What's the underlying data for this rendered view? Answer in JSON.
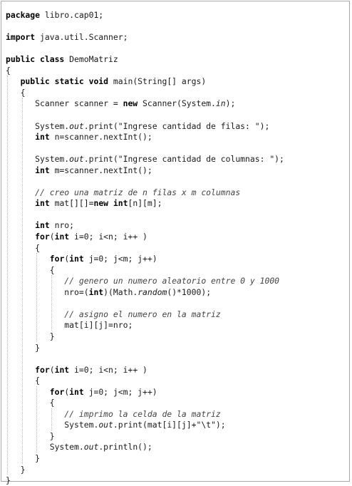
{
  "code": {
    "lines": [
      [
        {
          "t": "package",
          "c": "kw"
        },
        {
          "t": " libro.cap01;"
        }
      ],
      [],
      [
        {
          "t": "import",
          "c": "kw"
        },
        {
          "t": " java.util.Scanner;"
        }
      ],
      [],
      [
        {
          "t": "public class",
          "c": "kw"
        },
        {
          "t": " DemoMatriz"
        }
      ],
      [
        {
          "t": "{"
        }
      ],
      [
        {
          "t": "   "
        },
        {
          "t": "public static void",
          "c": "kw"
        },
        {
          "t": " main(String[] args)"
        }
      ],
      [
        {
          "t": "   {"
        }
      ],
      [
        {
          "t": "      Scanner scanner = "
        },
        {
          "t": "new",
          "c": "kw"
        },
        {
          "t": " Scanner(System."
        },
        {
          "t": "in",
          "c": "it"
        },
        {
          "t": ");"
        }
      ],
      [],
      [
        {
          "t": "      System."
        },
        {
          "t": "out",
          "c": "it"
        },
        {
          "t": ".print(\"Ingrese cantidad de filas: \");"
        }
      ],
      [
        {
          "t": "      "
        },
        {
          "t": "int",
          "c": "kw"
        },
        {
          "t": " n=scanner.nextInt();"
        }
      ],
      [],
      [
        {
          "t": "      System."
        },
        {
          "t": "out",
          "c": "it"
        },
        {
          "t": ".print(\"Ingrese cantidad de columnas: \");"
        }
      ],
      [
        {
          "t": "      "
        },
        {
          "t": "int",
          "c": "kw"
        },
        {
          "t": " m=scanner.nextInt();"
        }
      ],
      [],
      [
        {
          "t": "      "
        },
        {
          "t": "// creo una matriz de n filas x m columnas",
          "c": "cm"
        }
      ],
      [
        {
          "t": "      "
        },
        {
          "t": "int",
          "c": "kw"
        },
        {
          "t": " mat[][]="
        },
        {
          "t": "new int",
          "c": "kw"
        },
        {
          "t": "[n][m];"
        }
      ],
      [],
      [
        {
          "t": "      "
        },
        {
          "t": "int",
          "c": "kw"
        },
        {
          "t": " nro;"
        }
      ],
      [
        {
          "t": "      "
        },
        {
          "t": "for",
          "c": "kw"
        },
        {
          "t": "("
        },
        {
          "t": "int",
          "c": "kw"
        },
        {
          "t": " i=0; i<n; i++ )"
        }
      ],
      [
        {
          "t": "      {"
        }
      ],
      [
        {
          "t": "         "
        },
        {
          "t": "for",
          "c": "kw"
        },
        {
          "t": "("
        },
        {
          "t": "int",
          "c": "kw"
        },
        {
          "t": " j=0; j<m; j++)"
        }
      ],
      [
        {
          "t": "         {"
        }
      ],
      [
        {
          "t": "            "
        },
        {
          "t": "// genero un numero aleatorio entre 0 y 1000",
          "c": "cm"
        }
      ],
      [
        {
          "t": "            nro=("
        },
        {
          "t": "int",
          "c": "kw"
        },
        {
          "t": ")(Math."
        },
        {
          "t": "random",
          "c": "it"
        },
        {
          "t": "()*1000);"
        }
      ],
      [],
      [
        {
          "t": "            "
        },
        {
          "t": "// asigno el numero en la matriz",
          "c": "cm"
        }
      ],
      [
        {
          "t": "            mat[i][j]=nro;"
        }
      ],
      [
        {
          "t": "         }"
        }
      ],
      [
        {
          "t": "      }"
        }
      ],
      [],
      [
        {
          "t": "      "
        },
        {
          "t": "for",
          "c": "kw"
        },
        {
          "t": "("
        },
        {
          "t": "int",
          "c": "kw"
        },
        {
          "t": " i=0; i<n; i++ )"
        }
      ],
      [
        {
          "t": "      {"
        }
      ],
      [
        {
          "t": "         "
        },
        {
          "t": "for",
          "c": "kw"
        },
        {
          "t": "("
        },
        {
          "t": "int",
          "c": "kw"
        },
        {
          "t": " j=0; j<m; j++)"
        }
      ],
      [
        {
          "t": "         {"
        }
      ],
      [
        {
          "t": "            "
        },
        {
          "t": "// imprimo la celda de la matriz",
          "c": "cm"
        }
      ],
      [
        {
          "t": "            System."
        },
        {
          "t": "out",
          "c": "it"
        },
        {
          "t": ".print(mat[i][j]+\"\\t\");"
        }
      ],
      [
        {
          "t": "         }"
        }
      ],
      [
        {
          "t": "         System."
        },
        {
          "t": "out",
          "c": "it"
        },
        {
          "t": ".println();"
        }
      ],
      [
        {
          "t": "      }"
        }
      ],
      [
        {
          "t": "   }"
        }
      ],
      [
        {
          "t": "}"
        }
      ]
    ]
  }
}
